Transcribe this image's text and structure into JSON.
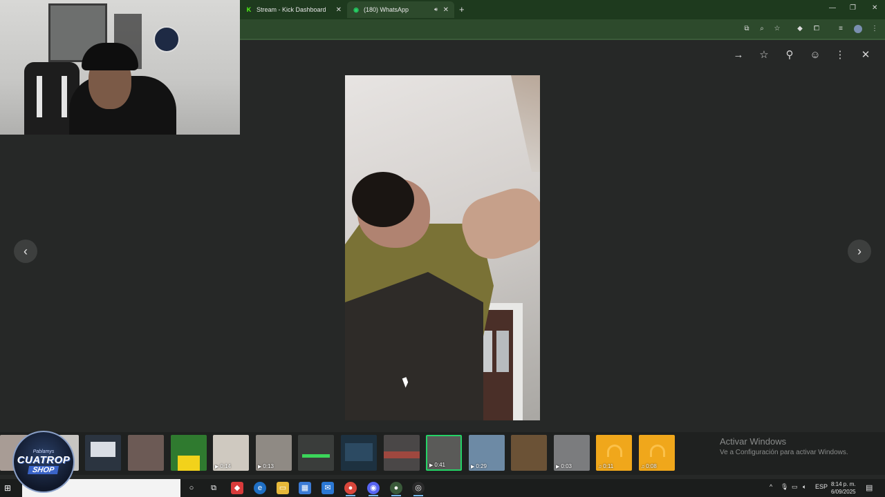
{
  "browser": {
    "tabs": [
      {
        "title": "Stream - Kick Dashboard",
        "favicon": "kick-icon",
        "active": false
      },
      {
        "title": "(180) WhatsApp",
        "favicon": "whatsapp-icon",
        "active": true
      }
    ],
    "toolbar_icons": [
      "cast-icon",
      "zoom-icon",
      "bookmark-star-icon",
      "extension-diamond-icon",
      "extensions-puzzle-icon",
      "media-controls-icon",
      "profile-avatar",
      "menu-kebab-icon"
    ]
  },
  "viewer": {
    "top_actions": [
      "forward-icon",
      "star-icon",
      "pin-icon",
      "react-emoji-icon",
      "more-options-icon",
      "close-icon"
    ],
    "thumbnails": [
      {
        "duration": "",
        "type": "image"
      },
      {
        "duration": "",
        "type": "image"
      },
      {
        "duration": "",
        "type": "image"
      },
      {
        "duration": "",
        "type": "image"
      },
      {
        "duration": "0:14",
        "type": "video"
      },
      {
        "duration": "0:13",
        "type": "video"
      },
      {
        "duration": "",
        "type": "image"
      },
      {
        "duration": "",
        "type": "image"
      },
      {
        "duration": "",
        "type": "image"
      },
      {
        "duration": "0:41",
        "type": "video",
        "selected": true
      },
      {
        "duration": "0:29",
        "type": "video"
      },
      {
        "duration": "",
        "type": "image"
      },
      {
        "duration": "0:03",
        "type": "video"
      },
      {
        "duration": "0:11",
        "type": "audio"
      },
      {
        "duration": "0:08",
        "type": "audio"
      }
    ]
  },
  "watermark": {
    "title": "Activar Windows",
    "subtitle": "Ve a Configuración para activar Windows."
  },
  "brand_logo": {
    "top": "Pablamys",
    "name": "CUATROP",
    "tag": "SHOP"
  },
  "taskbar": {
    "language": "ESP",
    "time": "8:14 p. m.",
    "date": "6/09/2025"
  },
  "colors": {
    "whatsapp_green": "#25d366",
    "audio_thumb": "#f0a71b",
    "chrome_frame": "#1e3a1e"
  }
}
